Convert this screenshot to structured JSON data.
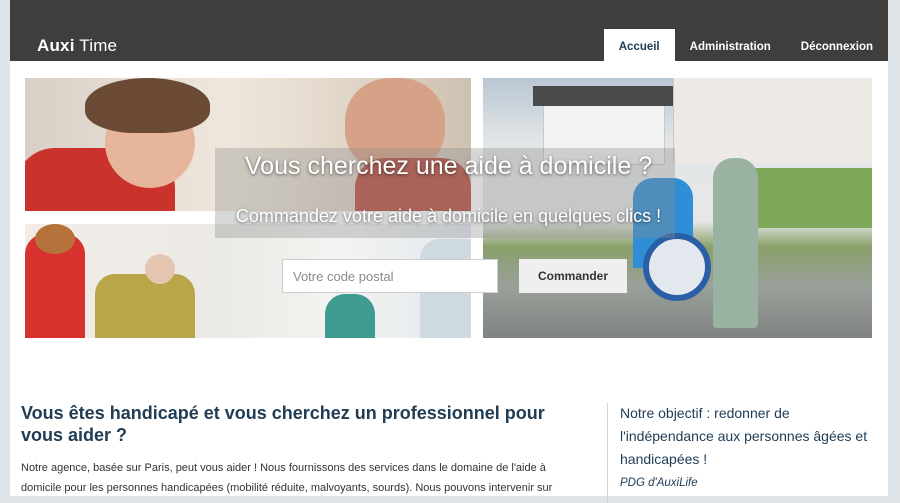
{
  "navbar": {
    "brand_bold": "Auxi",
    "brand_light": "Time",
    "items": [
      {
        "label": "Accueil",
        "active": true
      },
      {
        "label": "Administration",
        "active": false
      },
      {
        "label": "Déconnexion",
        "active": false
      }
    ]
  },
  "hero": {
    "title": "Vous cherchez une aide à domicile ?",
    "subtitle": "Commandez votre aide à domicile en quelques clics !",
    "postal_placeholder": "Votre code postal",
    "order_button": "Commander"
  },
  "main": {
    "heading": "Vous êtes handicapé et vous cherchez un professionnel pour vous aider ?",
    "paragraph": "Notre agence, basée sur Paris, peut vous aider ! Nous fournissons des services dans le domaine de l'aide à domicile pour les personnes handicapées (mobilité réduite, malvoyants, sourds). Nous pouvons intervenir sur"
  },
  "aside": {
    "quote": "Notre objectif : redonner de l'indépendance aux personnes âgées et handicapées !",
    "signature": "PDG d'AuxiLife"
  },
  "colors": {
    "navbar": "#3f3e3c",
    "heading": "#213d55",
    "page_bg": "#dfe4e8"
  }
}
